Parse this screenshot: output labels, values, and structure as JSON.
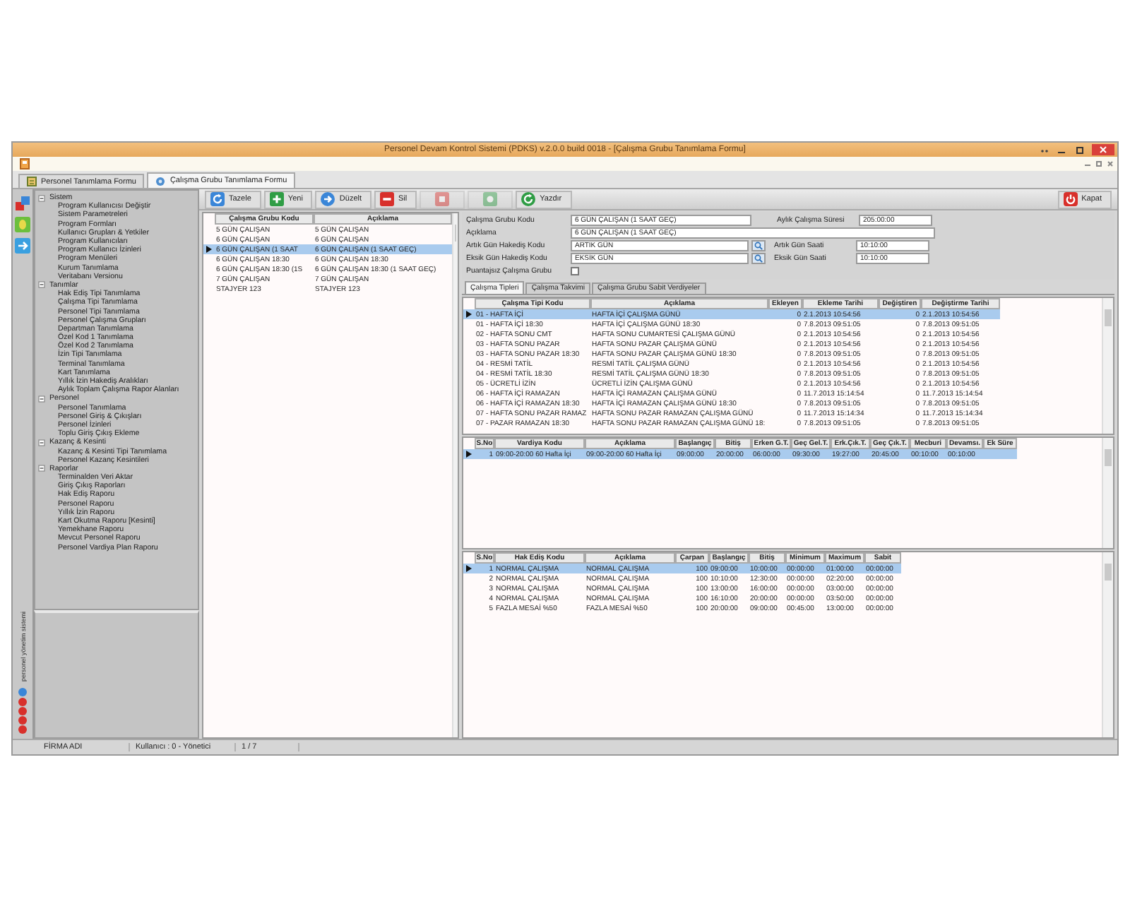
{
  "window": {
    "title": "Personel Devam Kontrol Sistemi (PDKS) v.2.0.0 build 0018 - [Çalışma Grubu Tanımlama Formu]"
  },
  "doc_tabs": [
    {
      "label": "Personel Tanımlama Formu",
      "selected": false
    },
    {
      "label": "Çalışma Grubu Tanımlama Formu",
      "selected": true
    }
  ],
  "toolbar": {
    "buttons": [
      {
        "kind": "refresh",
        "label": "Tazele",
        "disabled": false
      },
      {
        "kind": "new",
        "label": "Yeni",
        "disabled": false
      },
      {
        "kind": "edit",
        "label": "Düzelt",
        "disabled": false
      },
      {
        "kind": "delete",
        "label": "Sil",
        "disabled": false
      },
      {
        "kind": "save",
        "disabled": true
      },
      {
        "kind": "cancel",
        "disabled": true
      },
      {
        "kind": "print",
        "label": "Yazdır",
        "disabled": false
      },
      {
        "kind": "close",
        "label": "Kapat",
        "disabled": false
      }
    ]
  },
  "tree": {
    "items": [
      {
        "label": "Sistem",
        "expanded": true,
        "children": [
          {
            "label": "Program Kullanıcısı Değiştir"
          },
          {
            "label": "Sistem Parametreleri"
          },
          {
            "label": "Program Formları"
          },
          {
            "label": "Kullanıcı Grupları & Yetkiler"
          },
          {
            "label": "Program Kullanıcıları"
          },
          {
            "label": "Program Kullanıcı İzinleri"
          },
          {
            "label": "Program Menüleri"
          },
          {
            "label": "Kurum Tanımlama"
          },
          {
            "label": "Veritabanı Versionu"
          }
        ]
      },
      {
        "label": "Tanımlar",
        "expanded": true,
        "children": [
          {
            "label": "Hak Ediş Tipi Tanımlama"
          },
          {
            "label": "Çalışma Tipi Tanımlama"
          },
          {
            "label": "Personel Tipi Tanımlama"
          },
          {
            "label": "Personel Çalışma Grupları"
          },
          {
            "label": "Departman Tanımlama"
          },
          {
            "label": "Özel Kod 1 Tanımlama"
          },
          {
            "label": "Özel Kod 2 Tanımlama"
          },
          {
            "label": "İzin Tipi Tanımlama"
          },
          {
            "label": "Terminal Tanımlama"
          },
          {
            "label": "Kart Tanımlama"
          },
          {
            "label": "Yıllık İzin Hakediş Aralıkları"
          },
          {
            "label": "Aylık Toplam Çalışma Rapor Alanları"
          }
        ]
      },
      {
        "label": "Personel",
        "expanded": true,
        "children": [
          {
            "label": "Personel Tanımlama"
          },
          {
            "label": "Personel Giriş & Çıkışları"
          },
          {
            "label": "Personel İzinleri"
          },
          {
            "label": "Toplu Giriş Çıkış Ekleme"
          }
        ]
      },
      {
        "label": "Kazanç & Kesinti",
        "expanded": true,
        "children": [
          {
            "label": "Kazanç & Kesinti Tipi Tanımlama"
          },
          {
            "label": "Personel Kazanç Kesintileri"
          }
        ]
      },
      {
        "label": "Raporlar",
        "expanded": true,
        "children": [
          {
            "label": "Terminalden Veri Aktar"
          },
          {
            "label": "Giriş Çıkış Raporları"
          },
          {
            "label": "Hak Ediş Raporu"
          },
          {
            "label": "Personel Raporu"
          },
          {
            "label": "Yıllık İzin Raporu"
          },
          {
            "label": "Kart Okutma Raporu [Kesinti]"
          },
          {
            "label": "Yemekhane Raporu"
          },
          {
            "label": "Mevcut Personel Raporu"
          },
          {
            "label": "Personel Vardiya Plan Raporu"
          }
        ]
      }
    ]
  },
  "logo": {
    "tagline": "personel yönetim sistemi"
  },
  "group_list": {
    "columns": [
      "Çalışma Grubu Kodu",
      "Açıklama"
    ],
    "rows": [
      {
        "cells": [
          "5 GÜN ÇALIŞAN",
          "5 GÜN ÇALIŞAN"
        ],
        "selected": false
      },
      {
        "cells": [
          "6 GÜN ÇALIŞAN",
          "6 GÜN ÇALIŞAN"
        ],
        "selected": false
      },
      {
        "cells": [
          "6 GÜN ÇALIŞAN (1 SAAT",
          "6 GÜN ÇALIŞAN (1 SAAT GEÇ)"
        ],
        "selected": true
      },
      {
        "cells": [
          "6 GÜN ÇALIŞAN 18:30",
          "6 GÜN ÇALIŞAN 18:30"
        ],
        "selected": false
      },
      {
        "cells": [
          "6 GÜN ÇALIŞAN 18:30 (1S",
          "6 GÜN ÇALIŞAN 18:30 (1 SAAT GEÇ)"
        ],
        "selected": false
      },
      {
        "cells": [
          "7 GÜN ÇALIŞAN",
          "7 GÜN ÇALIŞAN"
        ],
        "selected": false
      },
      {
        "cells": [
          "STAJYER 123",
          "STAJYER 123"
        ],
        "selected": false
      }
    ]
  },
  "form": {
    "rows": [
      {
        "fields": [
          {
            "kind": "text",
            "label": "Çalışma Grubu Kodu",
            "value": "6 GÜN ÇALIŞAN (1 SAAT GEÇ)"
          },
          {
            "kind": "text",
            "label": "Aylık Çalışma Süresi",
            "value": "205:00:00"
          }
        ]
      },
      {
        "fields": [
          {
            "kind": "wide",
            "label": "Açıklama",
            "value": "6 GÜN ÇALIŞAN (1 SAAT GEÇ)"
          }
        ]
      },
      {
        "fields": [
          {
            "kind": "lookup",
            "label": "Artık Gün Hakediş Kodu",
            "value": "ARTIK GÜN"
          },
          {
            "kind": "text",
            "label": "Artık Gün Saati",
            "value": "10:10:00"
          }
        ]
      },
      {
        "fields": [
          {
            "kind": "lookup",
            "label": "Eksik Gün Hakediş Kodu",
            "value": "EKSİK GÜN"
          },
          {
            "kind": "text",
            "label": "Eksik Gün Saati",
            "value": "10:10:00"
          }
        ]
      },
      {
        "fields": [
          {
            "kind": "checkbox",
            "label": "Puantajsız Çalışma Grubu",
            "checked": false
          }
        ]
      }
    ]
  },
  "detail_tabs": [
    {
      "label": "Çalışma Tipleri",
      "selected": true
    },
    {
      "label": "Çalışma Takvimi",
      "selected": false
    },
    {
      "label": "Çalışma Grubu Sabit Verdiyeler",
      "selected": false
    }
  ],
  "work_types_table": {
    "columns": [
      "Çalışma Tipi Kodu",
      "Açıklama",
      "Ekleyen",
      "Ekleme Tarihi",
      "Değiştiren",
      "Değiştirme Tarihi"
    ],
    "rows": [
      {
        "cells": [
          "01 - HAFTA İÇİ",
          "HAFTA İÇİ ÇALIŞMA GÜNÜ",
          "0",
          "2.1.2013 10:54:56",
          "0",
          "2.1.2013 10:54:56"
        ],
        "selected": true
      },
      {
        "cells": [
          "01 - HAFTA İÇİ 18:30",
          "HAFTA İÇİ ÇALIŞMA GÜNÜ 18:30",
          "0",
          "7.8.2013 09:51:05",
          "0",
          "7.8.2013 09:51:05"
        ],
        "selected": false
      },
      {
        "cells": [
          "02 - HAFTA SONU CMT",
          "HAFTA SONU CUMARTESİ ÇALIŞMA GÜNÜ",
          "0",
          "2.1.2013 10:54:56",
          "0",
          "2.1.2013 10:54:56"
        ],
        "selected": false
      },
      {
        "cells": [
          "03 - HAFTA SONU PAZAR",
          "HAFTA SONU PAZAR ÇALIŞMA GÜNÜ",
          "0",
          "2.1.2013 10:54:56",
          "0",
          "2.1.2013 10:54:56"
        ],
        "selected": false
      },
      {
        "cells": [
          "03 - HAFTA SONU PAZAR 18:30",
          "HAFTA SONU PAZAR ÇALIŞMA GÜNÜ 18:30",
          "0",
          "7.8.2013 09:51:05",
          "0",
          "7.8.2013 09:51:05"
        ],
        "selected": false
      },
      {
        "cells": [
          "04 - RESMİ TATİL",
          "RESMİ TATİL ÇALIŞMA GÜNÜ",
          "0",
          "2.1.2013 10:54:56",
          "0",
          "2.1.2013 10:54:56"
        ],
        "selected": false
      },
      {
        "cells": [
          "04 - RESMİ TATİL 18:30",
          "RESMİ TATİL ÇALIŞMA GÜNÜ 18:30",
          "0",
          "7.8.2013 09:51:05",
          "0",
          "7.8.2013 09:51:05"
        ],
        "selected": false
      },
      {
        "cells": [
          "05 - ÜCRETLİ İZİN",
          "ÜCRETLİ İZİN ÇALIŞMA GÜNÜ",
          "0",
          "2.1.2013 10:54:56",
          "0",
          "2.1.2013 10:54:56"
        ],
        "selected": false
      },
      {
        "cells": [
          "06 - HAFTA İÇİ RAMAZAN",
          "HAFTA İÇİ RAMAZAN ÇALIŞMA GÜNÜ",
          "0",
          "11.7.2013 15:14:54",
          "0",
          "11.7.2013 15:14:54"
        ],
        "selected": false
      },
      {
        "cells": [
          "06 - HAFTA İÇİ RAMAZAN 18:30",
          "HAFTA İÇİ RAMAZAN ÇALIŞMA GÜNÜ 18:30",
          "0",
          "7.8.2013 09:51:05",
          "0",
          "7.8.2013 09:51:05"
        ],
        "selected": false
      },
      {
        "cells": [
          "07 - HAFTA SONU PAZAR RAMAZ",
          "HAFTA SONU PAZAR RAMAZAN ÇALIŞMA GÜNÜ",
          "0",
          "11.7.2013 15:14:34",
          "0",
          "11.7.2013 15:14:34"
        ],
        "selected": false
      },
      {
        "cells": [
          "07 - PAZAR RAMAZAN 18:30",
          "HAFTA SONU PAZAR RAMAZAN ÇALIŞMA GÜNÜ 18:",
          "0",
          "7.8.2013 09:51:05",
          "0",
          "7.8.2013 09:51:05"
        ],
        "selected": false
      }
    ]
  },
  "shift_table": {
    "columns": [
      "S.No",
      "Vardiya Kodu",
      "Açıklama",
      "Başlangıç",
      "Bitiş",
      "Erken G.T.",
      "Geç Gel.T.",
      "Erk.Çık.T.",
      "Geç Çık.T.",
      "Mecburi",
      "Devamsı.",
      "Ek Süre"
    ],
    "rows": [
      {
        "cells": [
          "1",
          "09:00-20:00 60 Hafta İçi",
          "09:00-20:00 60 Hafta İçi",
          "09:00:00",
          "20:00:00",
          "06:00:00",
          "09:30:00",
          "19:27:00",
          "20:45:00",
          "00:10:00",
          "00:10:00"
        ],
        "selected": true
      }
    ]
  },
  "earnings_table": {
    "columns": [
      "S.No",
      "Hak Ediş Kodu",
      "Açıklama",
      "Çarpan",
      "Başlangıç",
      "Bitiş",
      "Minimum",
      "Maximum",
      "Sabit"
    ],
    "rows": [
      {
        "cells": [
          "1",
          "NORMAL ÇALIŞMA",
          "NORMAL ÇALIŞMA",
          "100",
          "09:00:00",
          "10:00:00",
          "00:00:00",
          "01:00:00",
          "00:00:00"
        ],
        "selected": true
      },
      {
        "cells": [
          "2",
          "NORMAL ÇALIŞMA",
          "NORMAL ÇALIŞMA",
          "100",
          "10:10:00",
          "12:30:00",
          "00:00:00",
          "02:20:00",
          "00:00:00"
        ],
        "selected": false
      },
      {
        "cells": [
          "3",
          "NORMAL ÇALIŞMA",
          "NORMAL ÇALIŞMA",
          "100",
          "13:00:00",
          "16:00:00",
          "00:00:00",
          "03:00:00",
          "00:00:00"
        ],
        "selected": false
      },
      {
        "cells": [
          "4",
          "NORMAL ÇALIŞMA",
          "NORMAL ÇALIŞMA",
          "100",
          "16:10:00",
          "20:00:00",
          "00:00:00",
          "03:50:00",
          "00:00:00"
        ],
        "selected": false
      },
      {
        "cells": [
          "5",
          "FAZLA MESAİ %50",
          "FAZLA MESAİ %50",
          "100",
          "20:00:00",
          "09:00:00",
          "00:45:00",
          "13:00:00",
          "00:00:00"
        ],
        "selected": false
      }
    ]
  },
  "status_bar": {
    "items": [
      "FİRMA ADI",
      "Kullanıcı : 0 - Yönetici",
      "1 / 7"
    ]
  }
}
